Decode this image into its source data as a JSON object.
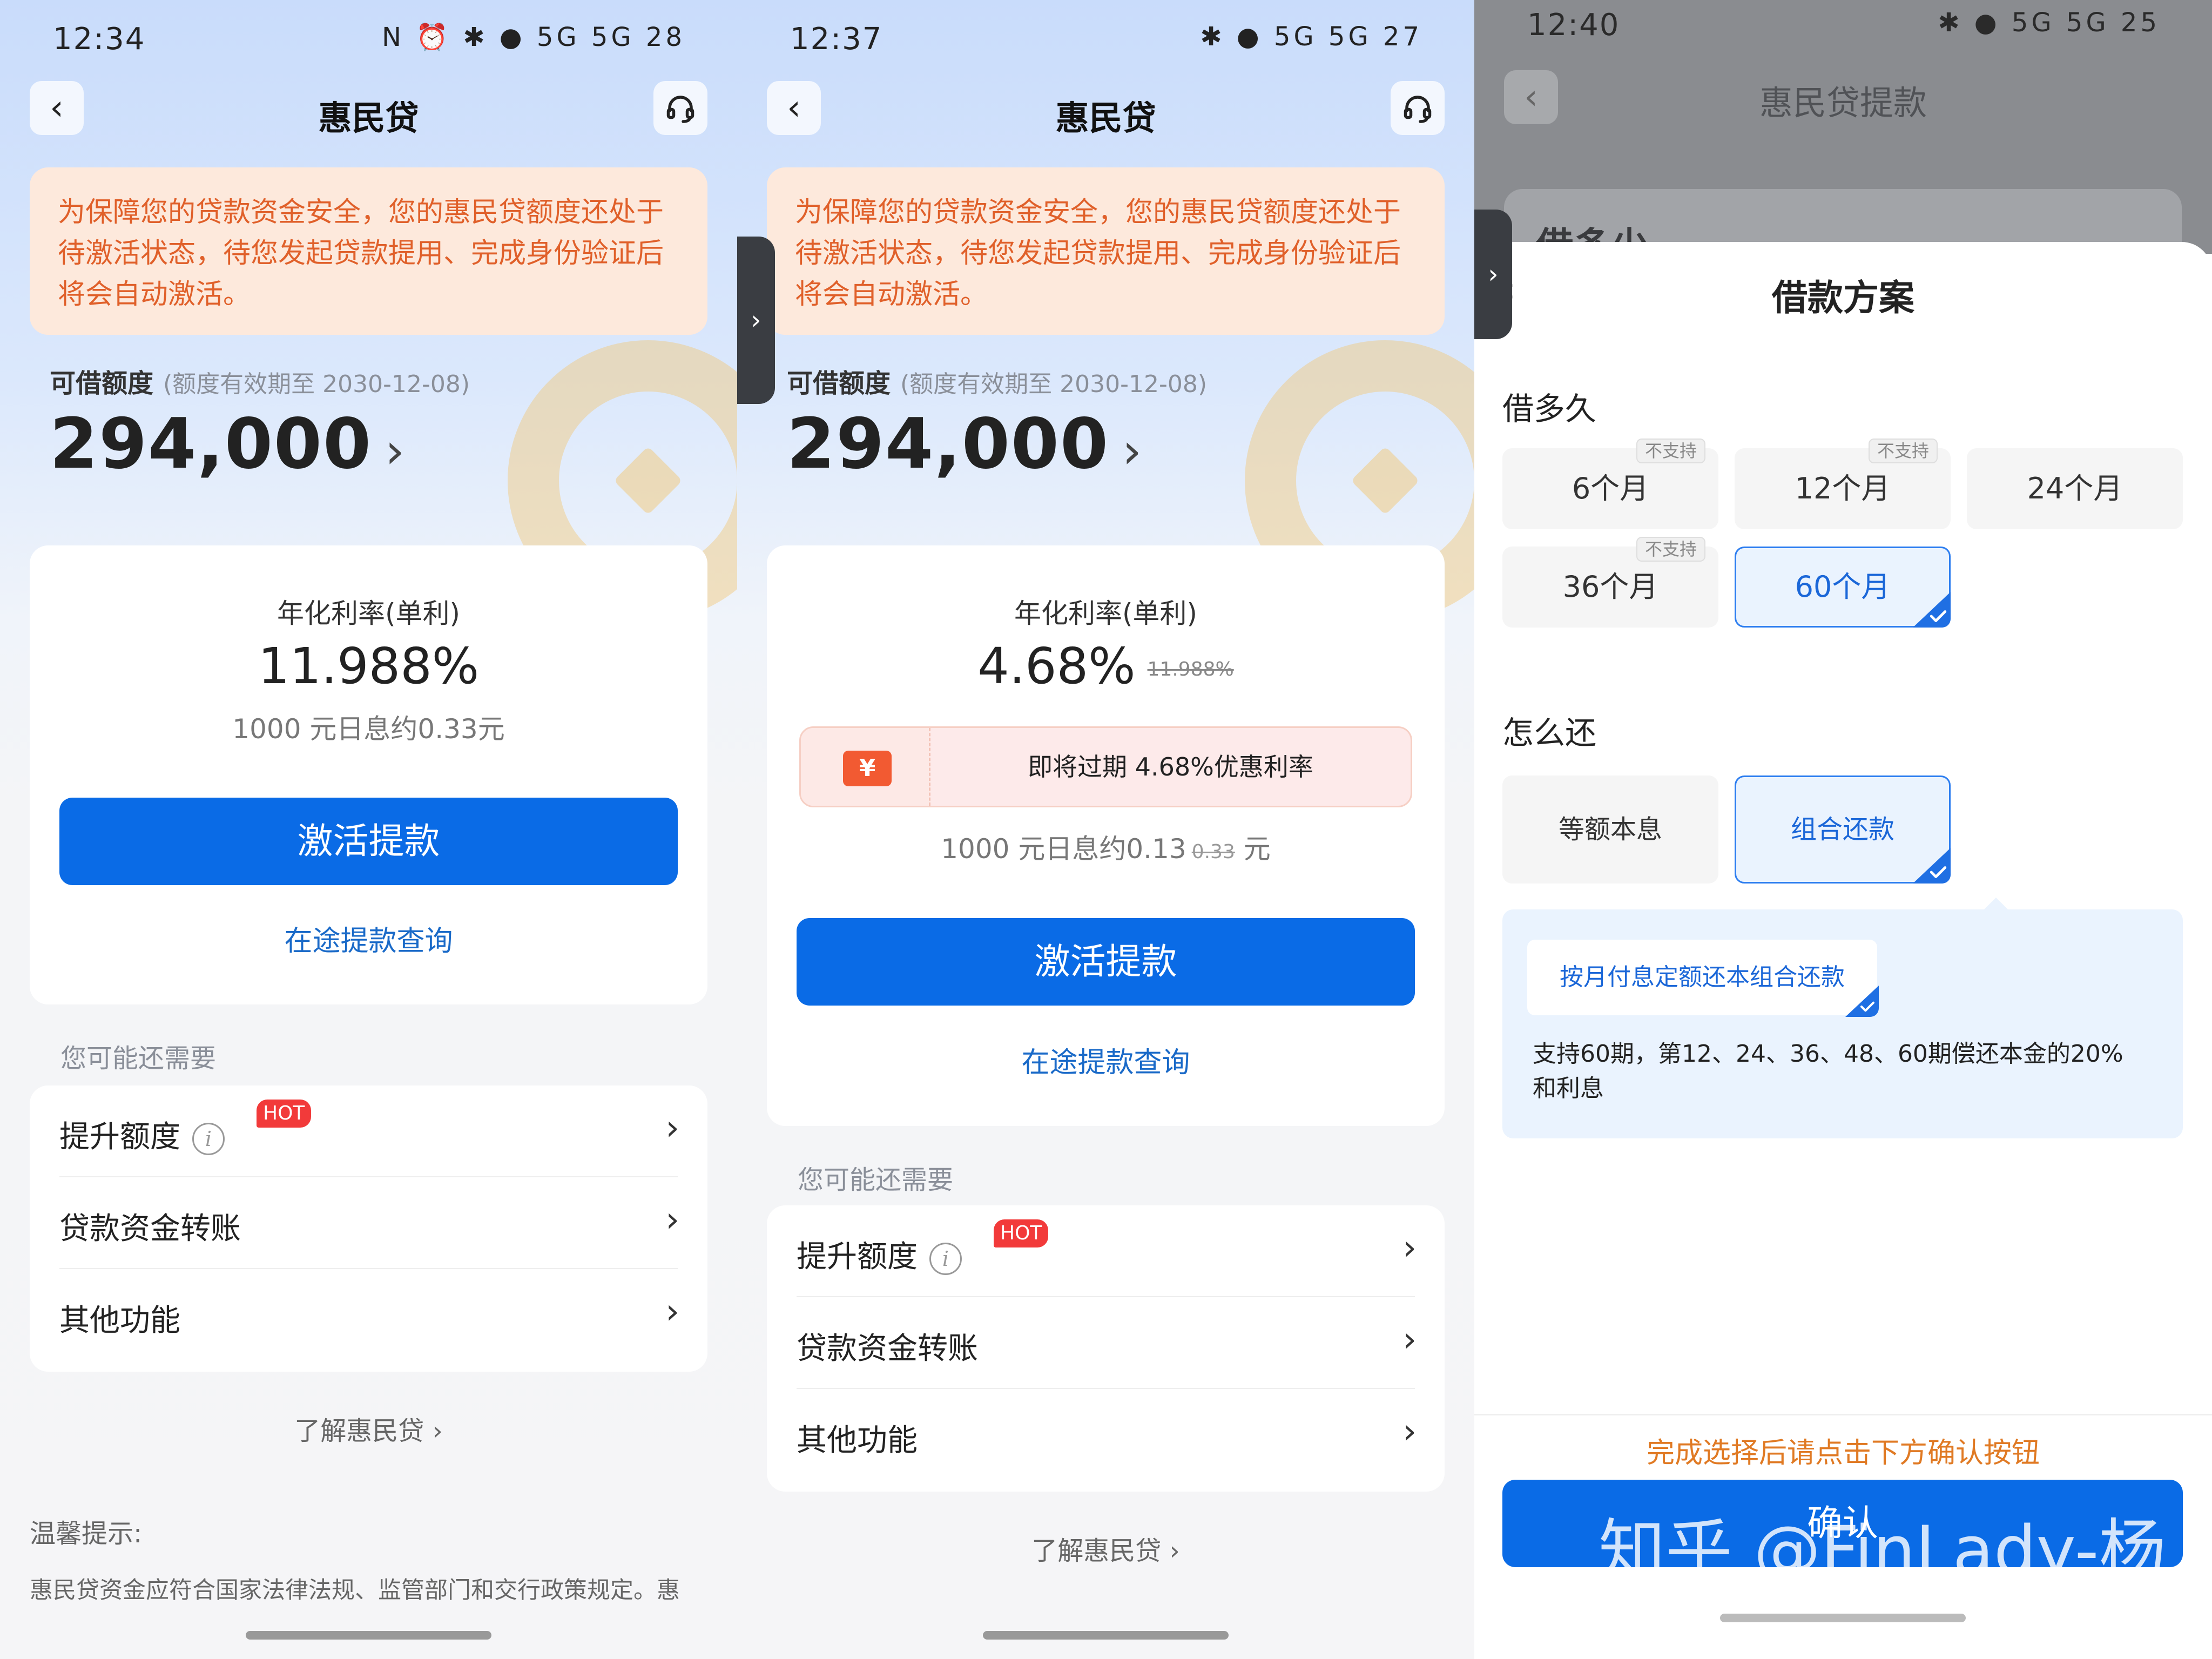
{
  "panel1": {
    "status": {
      "time": "12:34",
      "icons": "N ⏰ ✱ ● 5G 5G 28"
    },
    "nav": {
      "title": "惠民贷"
    },
    "notice": "为保障您的贷款资金安全，您的惠民贷额度还处于待激活状态，待您发起贷款提用、完成身份验证后将会自动激活。",
    "quota": {
      "label": "可借额度",
      "validity": "(额度有效期至 2030-12-08)",
      "amount": "294,000"
    },
    "rate": {
      "title": "年化利率(单利)",
      "value": "11.988%",
      "daily": "1000 元日息约0.33元"
    },
    "activate_label": "激活提款",
    "query_label": "在途提款查询",
    "more_title": "您可能还需要",
    "list": [
      {
        "label": "提升额度",
        "hot": "HOT"
      },
      {
        "label": "贷款资金转账"
      },
      {
        "label": "其他功能"
      }
    ],
    "about": "了解惠民贷 ›",
    "tip_title": "温馨提示:",
    "tip_text": "惠民贷资金应符合国家法律法规、监管部门和交行政策规定。惠"
  },
  "panel2": {
    "status": {
      "time": "12:37",
      "icons": "✱ ● 5G 5G 27"
    },
    "nav": {
      "title": "惠民贷"
    },
    "notice": "为保障您的贷款资金安全，您的惠民贷额度还处于待激活状态，待您发起贷款提用、完成身份验证后将会自动激活。",
    "quota": {
      "label": "可借额度",
      "validity": "(额度有效期至 2030-12-08)",
      "amount": "294,000"
    },
    "rate": {
      "title": "年化利率(单利)",
      "value": "4.68%",
      "old_value": "11.988%"
    },
    "promo": {
      "icon": "¥",
      "text": "即将过期 4.68%优惠利率"
    },
    "daily": {
      "prefix": "1000 元日息约0.13",
      "old": "0.33",
      "suffix": "元"
    },
    "activate_label": "激活提款",
    "query_label": "在途提款查询",
    "more_title": "您可能还需要",
    "list": [
      {
        "label": "提升额度",
        "hot": "HOT"
      },
      {
        "label": "贷款资金转账"
      },
      {
        "label": "其他功能"
      }
    ],
    "about": "了解惠民贷 ›"
  },
  "panel3": {
    "status": {
      "time": "12:40",
      "icons": "✱ ● 5G 5G 25"
    },
    "bg_title": "惠民贷提款",
    "bg_card_text": "借多少",
    "sheet_title": "借款方案",
    "term_title": "借多久",
    "terms": [
      {
        "label": "6个月",
        "tag": "不支持"
      },
      {
        "label": "12个月",
        "tag": "不支持"
      },
      {
        "label": "24个月"
      },
      {
        "label": "36个月",
        "tag": "不支持"
      },
      {
        "label": "60个月",
        "selected": true
      }
    ],
    "repay_title": "怎么还",
    "repay_options": [
      {
        "label": "等额本息"
      },
      {
        "label": "组合还款",
        "selected": true
      }
    ],
    "plan_chip": "按月付息定额还本组合还款",
    "plan_desc": "支持60期，第12、24、36、48、60期偿还本金的20%和利息",
    "hint": "完成选择后请点击下方确认按钮",
    "confirm_label": "确认"
  },
  "watermark": "知乎 @FinLady-杨",
  "colors": {
    "primary": "#0a6be6",
    "link": "#1a6ac8",
    "notice_text": "#e0602a",
    "hot": "#f23a3a",
    "hint": "#e07a24"
  }
}
